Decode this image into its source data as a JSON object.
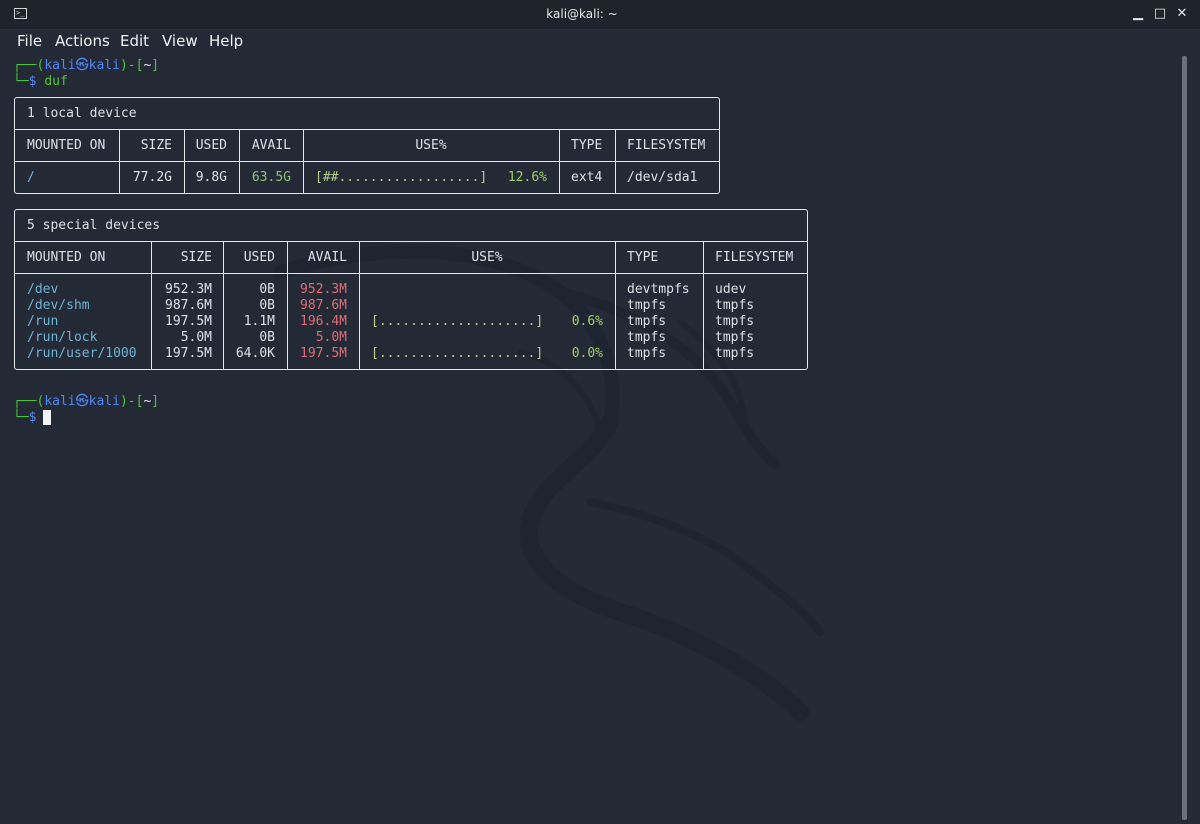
{
  "window": {
    "title": "kali@kali: ~",
    "icon": "terminal-icon",
    "buttons": {
      "minimize": "▁",
      "maximize": "□",
      "close": "✕"
    }
  },
  "menu": [
    "File",
    "Actions",
    "Edit",
    "View",
    "Help"
  ],
  "prompt": {
    "user": "kali",
    "at_symbol": "㉿",
    "host": "kali",
    "cwd": "~",
    "dollar": "$"
  },
  "command": "duf",
  "local_table": {
    "title": "1 local device",
    "headers": [
      "MOUNTED ON",
      "SIZE",
      "USED",
      "AVAIL",
      "USE%",
      "TYPE",
      "FILESYSTEM"
    ],
    "rows": [
      {
        "mounted": "/",
        "size": "77.2G",
        "used": "9.8G",
        "avail": "63.5G",
        "bar": "[##..................]",
        "pct": "12.6%",
        "type": "ext4",
        "fs": "/dev/sda1"
      }
    ]
  },
  "special_table": {
    "title": "5 special devices",
    "headers": [
      "MOUNTED ON",
      "SIZE",
      "USED",
      "AVAIL",
      "USE%",
      "TYPE",
      "FILESYSTEM"
    ],
    "rows": [
      {
        "mounted": "/dev",
        "size": "952.3M",
        "used": "0B",
        "avail": "952.3M",
        "bar": "",
        "pct": "",
        "type": "devtmpfs",
        "fs": "udev"
      },
      {
        "mounted": "/dev/shm",
        "size": "987.6M",
        "used": "0B",
        "avail": "987.6M",
        "bar": "",
        "pct": "",
        "type": "tmpfs",
        "fs": "tmpfs"
      },
      {
        "mounted": "/run",
        "size": "197.5M",
        "used": "1.1M",
        "avail": "196.4M",
        "bar": "[....................]",
        "pct": "0.6%",
        "type": "tmpfs",
        "fs": "tmpfs"
      },
      {
        "mounted": "/run/lock",
        "size": "5.0M",
        "used": "0B",
        "avail": "5.0M",
        "bar": "",
        "pct": "",
        "type": "tmpfs",
        "fs": "tmpfs"
      },
      {
        "mounted": "/run/user/1000",
        "size": "197.5M",
        "used": "64.0K",
        "avail": "197.5M",
        "bar": "[....................]",
        "pct": "0.0%",
        "type": "tmpfs",
        "fs": "tmpfs"
      }
    ]
  },
  "colors": {
    "background": "#232a36",
    "prompt_green": "#4ec23c",
    "prompt_blue": "#4f86f7",
    "mount_teal": "#6fb3d2",
    "avail_green": "#8fc277",
    "avail_red": "#e06c75"
  }
}
